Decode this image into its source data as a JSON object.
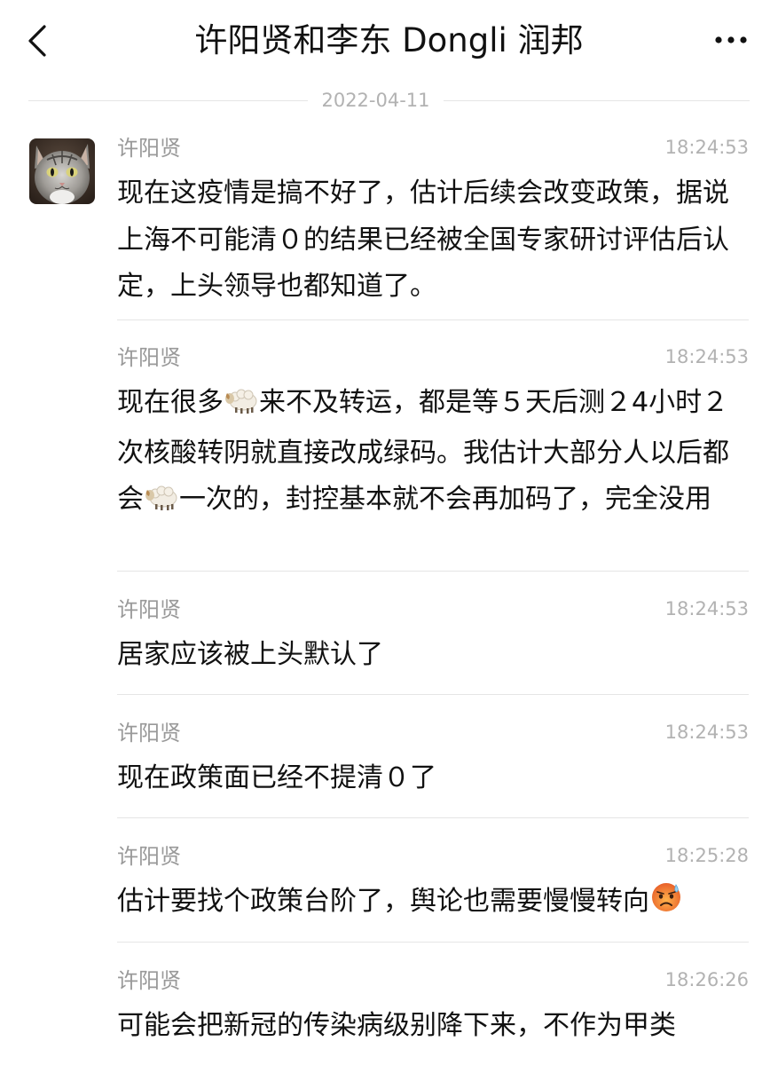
{
  "header": {
    "back_icon": "chevron-left-icon",
    "title": "许阳贤和李东 Dongli 润邦",
    "more_icon": "ellipsis-icon"
  },
  "date_divider": "2022-04-11",
  "messages": [
    {
      "sender": "许阳贤",
      "time": "18:24:53",
      "text": "现在这疫情是搞不好了，估计后续会改变政策，据说上海不可能清０的结果已经被全国专家研讨评估后认定，上头领导也都知道了。",
      "has_avatar": true
    },
    {
      "sender": "许阳贤",
      "time": "18:24:53",
      "text_parts": [
        "现在很多",
        "来不及转运，都是等５天后测２4小时２次核酸转阴就直接改成绿码。我估计大部分人以后都会",
        "一次的，封控基本就不会再加码了，完全没用"
      ],
      "emojis": [
        "sheep-emoji",
        "sheep-emoji"
      ]
    },
    {
      "sender": "许阳贤",
      "time": "18:24:53",
      "text": "居家应该被上头默认了"
    },
    {
      "sender": "许阳贤",
      "time": "18:24:53",
      "text": "现在政策面已经不提清０了"
    },
    {
      "sender": "许阳贤",
      "time": "18:25:28",
      "text": "估计要找个政策台阶了，舆论也需要慢慢转向",
      "trailing_emoji": "anxious-sweat-face-emoji"
    },
    {
      "sender": "许阳贤",
      "time": "18:26:26",
      "text": "可能会把新冠的传染病级别降下来，不作为甲类"
    }
  ],
  "colors": {
    "background": "#ffffff",
    "primary_text": "#111111",
    "secondary_text": "#999999",
    "timestamp": "#b2b2b2",
    "divider": "#e5e5e5"
  }
}
